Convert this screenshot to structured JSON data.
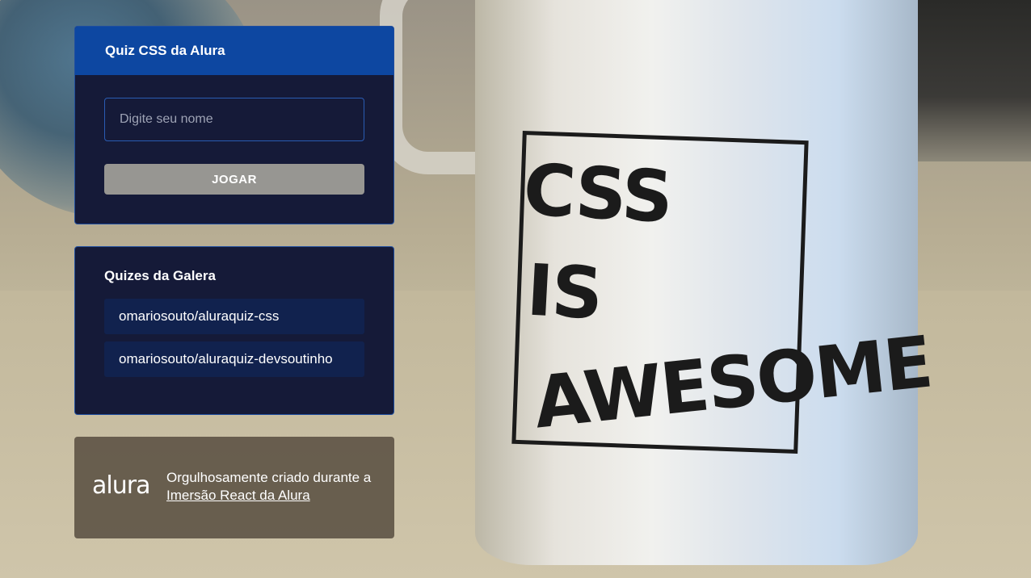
{
  "background": {
    "mug_text": [
      "CSS",
      "IS",
      "AWESOME"
    ]
  },
  "quiz_widget": {
    "title": "Quiz CSS da Alura",
    "name_input_placeholder": "Digite seu nome",
    "name_input_value": "",
    "play_button_label": "JOGAR"
  },
  "community_widget": {
    "title": "Quizes da Galera",
    "items": [
      {
        "label": "omariosouto/aluraquiz-css"
      },
      {
        "label": "omariosouto/aluraquiz-devsoutinho"
      }
    ]
  },
  "footer": {
    "logo_text": "alura",
    "text": "Orgulhosamente criado durante a",
    "link_text": "Imersão React da Alura"
  },
  "colors": {
    "header_blue": "#0d47a1",
    "widget_bg": "#151a38",
    "button_gray": "#979692",
    "list_item_bg": "#11224e"
  }
}
